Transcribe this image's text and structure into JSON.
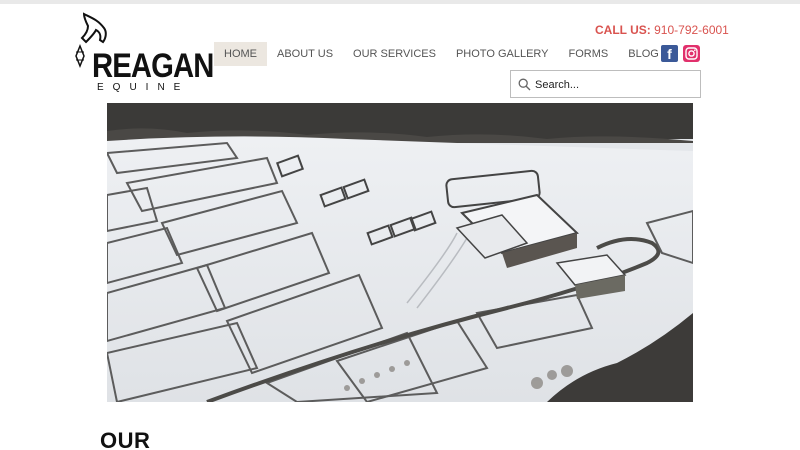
{
  "brand": {
    "name": "REAGAN",
    "tagline": "EQUINE"
  },
  "nav": {
    "items": [
      {
        "label": "HOME",
        "active": true
      },
      {
        "label": "ABOUT US",
        "active": false
      },
      {
        "label": "OUR SERVICES",
        "active": false
      },
      {
        "label": "PHOTO GALLERY",
        "active": false
      },
      {
        "label": "FORMS",
        "active": false
      },
      {
        "label": "BLOG",
        "active": false
      }
    ]
  },
  "contact": {
    "call_label": "CALL US:",
    "phone": "910-792-6001"
  },
  "social": [
    {
      "name": "facebook",
      "icon": "facebook-icon",
      "color": "#3b5998"
    },
    {
      "name": "instagram",
      "icon": "instagram-icon",
      "color": "#e1306c"
    }
  ],
  "search": {
    "placeholder": "Search...",
    "value": ""
  },
  "hero": {
    "icon": "aerial-snowy-farm-photo"
  },
  "main": {
    "heading": "OUR"
  },
  "colors": {
    "accent": "#d9534f",
    "nav_active_bg": "#ece7e0",
    "nav_text": "#555555"
  }
}
